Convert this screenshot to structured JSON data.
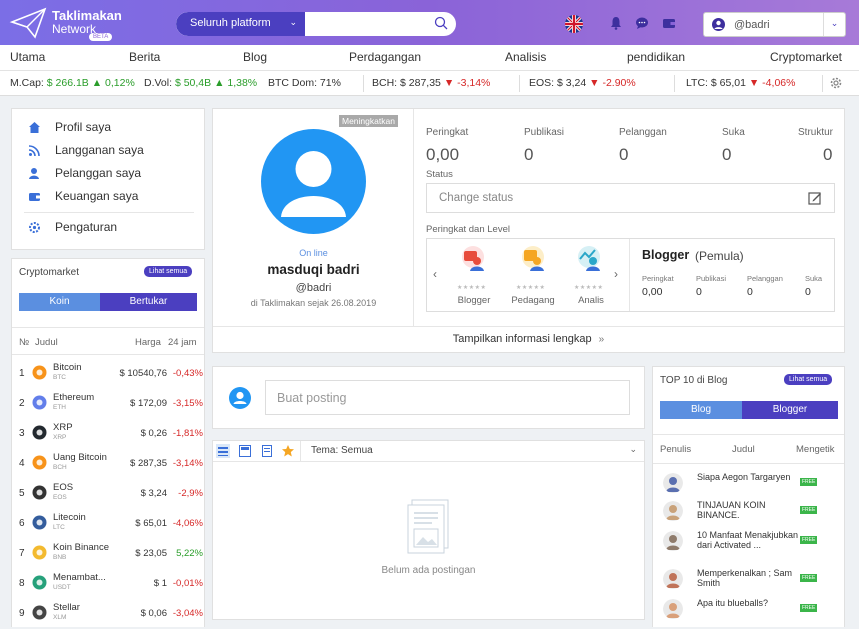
{
  "header": {
    "logo_line1": "Taklimakan",
    "logo_line2": "Network",
    "beta": "BETA",
    "search_scope": "Seluruh platform",
    "username": "@badri"
  },
  "nav": [
    "Utama",
    "Berita",
    "Blog",
    "Perdagangan",
    "Analisis",
    "pendidikan",
    "Cryptomarket"
  ],
  "ticker": {
    "mcap_label": "M.Cap:",
    "mcap_value": "$ 266.1B",
    "mcap_change": "▲ 0,12%",
    "dvol_label": "D.Vol:",
    "dvol_value": "$ 50,4B",
    "dvol_change": "▲ 1,38%",
    "btcdom": "BTC Dom: 71%",
    "bch_label": "BCH:",
    "bch_value": "$ 287,35",
    "bch_change": "▼ -3,14%",
    "eos_label": "EOS:",
    "eos_value": "$ 3,24",
    "eos_change": "▼ -2.90%",
    "ltc_label": "LTC:",
    "ltc_value": "$ 65,01",
    "ltc_change": "▼ -4,06%"
  },
  "menu": [
    "Profil saya",
    "Langganan saya",
    "Pelanggan saya",
    "Keuangan saya",
    "Pengaturan"
  ],
  "cryptomarket": {
    "title": "Cryptomarket",
    "see_all": "Lihat semua",
    "tab_active": "Koin",
    "tab_other": "Bertukar",
    "col_no": "№",
    "col_title": "Judul",
    "col_price": "Harga",
    "col_change": "24 jam",
    "rows": [
      {
        "n": "1",
        "name": "Bitcoin",
        "sym": "BTC",
        "price": "$ 10540,76",
        "chg": "-0,43%",
        "up": false
      },
      {
        "n": "2",
        "name": "Ethereum",
        "sym": "ETH",
        "price": "$ 172,09",
        "chg": "-3,15%",
        "up": false
      },
      {
        "n": "3",
        "name": "XRP",
        "sym": "XRP",
        "price": "$ 0,26",
        "chg": "-1,81%",
        "up": false
      },
      {
        "n": "4",
        "name": "Uang Bitcoin",
        "sym": "BCH",
        "price": "$ 287,35",
        "chg": "-3,14%",
        "up": false
      },
      {
        "n": "5",
        "name": "EOS",
        "sym": "EOS",
        "price": "$ 3,24",
        "chg": "-2,9%",
        "up": false
      },
      {
        "n": "6",
        "name": "Litecoin",
        "sym": "LTC",
        "price": "$ 65,01",
        "chg": "-4,06%",
        "up": false
      },
      {
        "n": "7",
        "name": "Koin Binance",
        "sym": "BNB",
        "price": "$ 23,05",
        "chg": "5,22%",
        "up": true
      },
      {
        "n": "8",
        "name": "Menambat...",
        "sym": "USDT",
        "price": "$ 1",
        "chg": "-0,01%",
        "up": false
      },
      {
        "n": "9",
        "name": "Stellar",
        "sym": "XLM",
        "price": "$ 0,06",
        "chg": "-3,04%",
        "up": false
      }
    ]
  },
  "profile": {
    "upgrade": "Meningkatkan",
    "online": "On line",
    "name": "masduqi badri",
    "handle": "@badri",
    "since": "di Taklimakan sejak 26.08.2019",
    "stats": [
      {
        "label": "Peringkat",
        "value": "0,00"
      },
      {
        "label": "Publikasi",
        "value": "0"
      },
      {
        "label": "Pelanggan",
        "value": "0"
      },
      {
        "label": "Suka",
        "value": "0"
      },
      {
        "label": "Struktur",
        "value": "0"
      }
    ],
    "status_label": "Status",
    "status_placeholder": "Change status",
    "level_label": "Peringkat dan Level",
    "roles": [
      "Blogger",
      "Pedagang",
      "Analis"
    ],
    "level_title": "Blogger",
    "level_sub": "(Pemula)",
    "level_stats": [
      {
        "label": "Peringkat",
        "value": "0,00"
      },
      {
        "label": "Publikasi",
        "value": "0"
      },
      {
        "label": "Pelanggan",
        "value": "0"
      },
      {
        "label": "Suka",
        "value": "0"
      }
    ],
    "show_full": "Tampilkan informasi lengkap"
  },
  "post": {
    "placeholder": "Buat posting",
    "filter": "Tema: Semua",
    "empty": "Belum ada postingan"
  },
  "top10": {
    "title": "TOP 10 di Blog",
    "see_all": "Lihat semua",
    "tab_other": "Blog",
    "tab_active": "Blogger",
    "col_writer": "Penulis",
    "col_title": "Judul",
    "col_type": "Mengetik",
    "free": "FREE",
    "rows": [
      {
        "title": "Siapa Aegon Targaryen"
      },
      {
        "title": "TINJAUAN KOIN BINANCE."
      },
      {
        "title": "10 Manfaat Menakjubkan dari Activated ..."
      },
      {
        "title": "Memperkenalkan ; Sam Smith"
      },
      {
        "title": "Apa itu blueballs?"
      }
    ]
  },
  "colors": {
    "accent": "#4b3fc0",
    "header": "#8a63d8",
    "positive": "#2a9d2a",
    "negative": "#d62828",
    "profile_blue": "#2196f3"
  }
}
